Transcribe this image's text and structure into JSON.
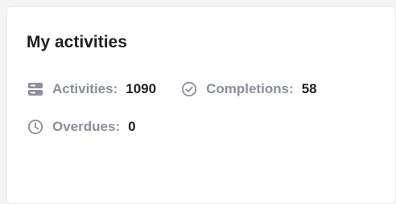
{
  "card": {
    "title": "My activities",
    "stats": [
      {
        "icon": "server-icon",
        "label": "Activities",
        "value": "1090"
      },
      {
        "icon": "check-circle-icon",
        "label": "Completions",
        "value": "58"
      },
      {
        "icon": "clock-icon",
        "label": "Overdues",
        "value": "0"
      }
    ]
  },
  "colors": {
    "title": "#1f1f1f",
    "label": "#8a8f99",
    "value": "#1f1f1f",
    "icon": "#8a8f99",
    "card_bg": "#ffffff",
    "page_bg": "#f5f5f5"
  }
}
